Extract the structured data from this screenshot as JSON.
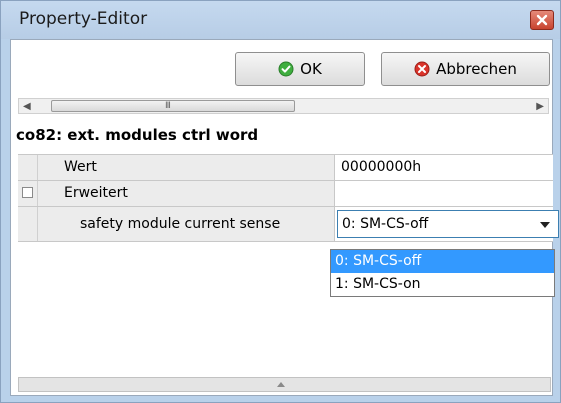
{
  "window": {
    "title": "Property-Editor"
  },
  "toolbar": {
    "ok_label": "OK",
    "cancel_label": "Abbrechen"
  },
  "scrollbar": {
    "grip": "III"
  },
  "section": {
    "title": "co82: ext. modules ctrl word"
  },
  "grid": {
    "rows": [
      {
        "name": "Wert",
        "value": "00000000h"
      },
      {
        "name": "Erweitert",
        "value": ""
      },
      {
        "name": "safety module current sense",
        "value": "0: SM-CS-off"
      }
    ]
  },
  "dropdown": {
    "options": [
      "0: SM-CS-off",
      "1: SM-CS-on"
    ],
    "highlighted": "0: SM-CS-off"
  },
  "colors": {
    "selection": "#3399ff",
    "title_bar": "#b9d1ea",
    "close": "#c8432f",
    "ok_icon": "#3fae3f",
    "cancel_icon": "#d9342b"
  },
  "icons": {
    "ok": "check-circle-icon",
    "cancel": "x-circle-icon",
    "close": "close-icon"
  }
}
